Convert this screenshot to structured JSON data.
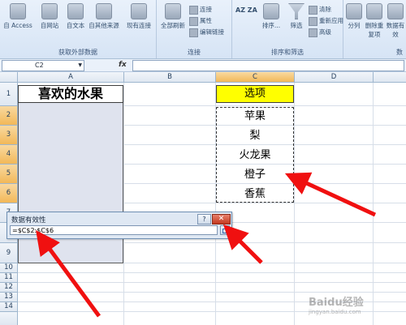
{
  "ribbon": {
    "groups": [
      {
        "label": "获取外部数据",
        "buttons": [
          "自 Access",
          "自网站",
          "自文本",
          "自其他来源",
          "现有连接"
        ]
      },
      {
        "label": "连接",
        "buttons": [
          "全部刷新"
        ],
        "small": [
          "连接",
          "属性",
          "编辑链接"
        ]
      },
      {
        "label": "排序和筛选",
        "buttons": [
          "排序...",
          "筛选"
        ],
        "small": [
          "清除",
          "重新应用",
          "高级"
        ]
      },
      {
        "label": "数",
        "buttons": [
          "分列",
          "删除重复项",
          "数据有效"
        ]
      }
    ],
    "sort_icon_text": "AZ ZA"
  },
  "formula_bar": {
    "name_box": "C2",
    "fx": "fx",
    "formula": ""
  },
  "columns": [
    "A",
    "B",
    "C",
    "D"
  ],
  "rows": [
    "1",
    "2",
    "3",
    "4",
    "5",
    "6",
    "7",
    "8",
    "9",
    "10",
    "11",
    "12",
    "13",
    "14"
  ],
  "cells": {
    "A1": "喜欢的水果",
    "C1": "选项",
    "C_items": [
      "苹果",
      "梨",
      "火龙果",
      "橙子",
      "香蕉"
    ]
  },
  "dialog": {
    "title": "数据有效性",
    "help": "?",
    "close": "✕",
    "reference": "=$C$2:$C$6"
  },
  "watermark": {
    "text": "Baidu经验",
    "sub": "jingyan.baidu.com"
  },
  "colors": {
    "arrow": "#f01010",
    "highlight": "#ffff00",
    "selected_header": "#f2b858"
  }
}
